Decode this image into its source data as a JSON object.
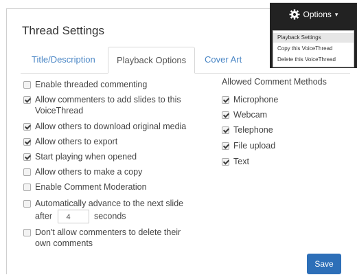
{
  "dialog": {
    "title": "Thread Settings"
  },
  "tabs": [
    {
      "label": "Title/Description",
      "active": false
    },
    {
      "label": "Playback Options",
      "active": true
    },
    {
      "label": "Cover Art",
      "active": false
    }
  ],
  "options": {
    "threaded": {
      "label": "Enable threaded commenting",
      "checked": false
    },
    "add_slides": {
      "label_line1": "Allow commenters to add slides to this",
      "label_line2": "VoiceThread",
      "checked": true
    },
    "download": {
      "label": "Allow others to download original media",
      "checked": true
    },
    "export": {
      "label": "Allow others to export",
      "checked": true
    },
    "autoplay": {
      "label": "Start playing when opened",
      "checked": true
    },
    "copy": {
      "label": "Allow others to make a copy",
      "checked": false
    },
    "moderation": {
      "label": "Enable Comment Moderation",
      "checked": false
    },
    "advance": {
      "label_line1": "Automatically advance to the next slide",
      "label_after": "after",
      "seconds_value": "4",
      "label_seconds": "seconds",
      "checked": false
    },
    "no_delete": {
      "label_line1": "Don't allow commenters to delete their",
      "label_line2": "own comments",
      "checked": false
    }
  },
  "methods": {
    "title": "Allowed Comment Methods",
    "items": [
      {
        "label": "Microphone",
        "checked": true
      },
      {
        "label": "Webcam",
        "checked": true
      },
      {
        "label": "Telephone",
        "checked": true
      },
      {
        "label": "File upload",
        "checked": true
      },
      {
        "label": "Text",
        "checked": true
      }
    ]
  },
  "save_label": "Save",
  "options_menu": {
    "button_label": "Options",
    "caret": "▾",
    "icon": "gear-icon",
    "items": [
      {
        "label": "Playback Settings",
        "highlighted": true
      },
      {
        "label": "Copy this VoiceThread",
        "highlighted": false
      },
      {
        "label": "Delete this VoiceThread",
        "highlighted": false
      }
    ]
  }
}
